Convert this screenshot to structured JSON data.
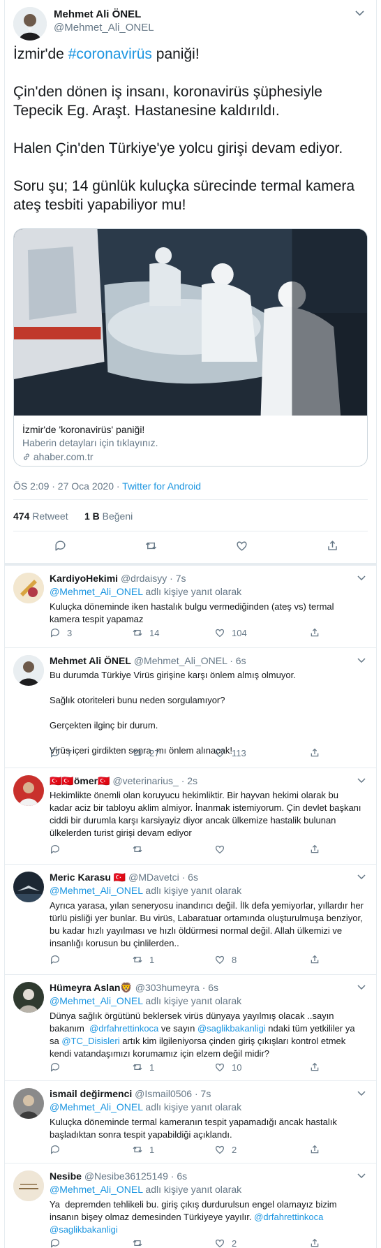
{
  "main_tweet": {
    "author_name": "Mehmet Ali ÖNEL",
    "author_handle": "@Mehmet_Ali_ONEL",
    "text_line1_prefix": "İzmir'de ",
    "text_line1_hashtag": "#coronavirüs",
    "text_line1_suffix": " paniği!",
    "text_rest": "Çin'den dönen iş insanı, koronavirüs şüphesiyle Tepecik Eg. Araşt. Hastanesine kaldırıldı.\n\nHalen Çin'den Türkiye'ye yolcu girişi devam ediyor.\n\nSoru şu; 14 günlük kuluçka sürecinde termal kamera ateş tesbiti yapabiliyor mu!",
    "card_title": "İzmir'de 'koronavirüs' paniği!",
    "card_description": "Haberin detayları için tıklayınız.",
    "card_url": "ahaber.com.tr",
    "timestamp": "ÖS 2:09 · 27 Oca 2020 · ",
    "source": "Twitter for Android",
    "retweets_count": "474",
    "retweets_label": "Retweet",
    "likes_count": "1 B",
    "likes_label": "Beğeni"
  },
  "replies": [
    {
      "name": "KardiyoHekimi",
      "handle": "@drdaisyy",
      "time": "· 7s",
      "reply_to_handle": "@Mehmet_Ali_ONEL",
      "reply_to_suffix": " adlı kişiye yanıt olarak",
      "text": "Kuluçka döneminde iken hastalık bulgu vermediğinden (ateş vs) termal kamera tespit yapamaz",
      "comments": "3",
      "retweets": "14",
      "likes": "104"
    },
    {
      "name": "Mehmet Ali ÖNEL",
      "handle": "@Mehmet_Ali_ONEL",
      "time": "· 6s",
      "text": "Bu durumda Türkiye Virüs girişine karşı önlem almış olmuyor.\n\nSağlık otoriteleri bunu neden sorgulamıyor?\n\nGerçekten ilginç bir durum.\n\nVirüs içeri girdikten sonra  mı önlem alınacak!",
      "comments": "7",
      "retweets": "27",
      "likes": "113"
    },
    {
      "name_flags_left": "🇹🇷🇹🇷",
      "name": "ömer",
      "name_flags_right": "🇹🇷",
      "handle": "@veterinarius_",
      "time": "· 2s",
      "text": "Hekimlikte önemli olan koruyucu hekimliktir. Bir hayvan hekimi olarak bu kadar aciz bir tabloyu aklim almiyor. İnanmak istemiyorum. Çin devlet başkanı ciddi bir durumla karşı karsiyayiz diyor ancak ülkemize hastalik bulunan ülkelerden turist girişi devam ediyor",
      "comments": "",
      "retweets": "",
      "likes": ""
    },
    {
      "name": "Meric Karasu",
      "name_flag": "🇹🇷",
      "handle": "@MDavetci",
      "time": "· 6s",
      "reply_to_handle": "@Mehmet_Ali_ONEL",
      "reply_to_suffix": " adlı kişiye yanıt olarak",
      "text": "Ayrıca yarasa, yılan seneryosu inandırıcı değil. İlk defa yemiyorlar, yıllardır her türlü pisliği yer bunlar. Bu virüs, Labaratuar ortamında oluşturulmuşa benziyor, bu kadar hızlı yayılması ve hızlı öldürmesi normal değil. Allah ülkemizi ve insanlığı korusun bu çinlilerden..",
      "comments": "",
      "retweets": "1",
      "likes": "8"
    },
    {
      "name": "Hümeyra Aslan",
      "name_emoji": "🦁",
      "handle": "@303humeyra",
      "time": "· 6s",
      "reply_to_handle": "@Mehmet_Ali_ONEL",
      "reply_to_suffix": " adlı kişiye yanıt olarak",
      "text_a": "Dünya sağlık örgütünü beklersek virüs dünyaya yayılmış olacak ..sayın bakanım  ",
      "mention_a": "@drfahrettinkoca",
      "text_b": " ve sayın ",
      "mention_b": "@saglikbakanligi",
      "text_c": " ndaki tüm yetkililer ya sa ",
      "mention_c": "@TC_Disisleri",
      "text_d": " artık kim ilgileniyorsa çinden giriş çıkışları kontrol etmek kendi vatandaşımızı korumamız için elzem değil midir?",
      "comments": "",
      "retweets": "1",
      "likes": "10"
    },
    {
      "name": "ismail değirmenci",
      "handle": "@Ismail0506",
      "time": "· 7s",
      "reply_to_handle": "@Mehmet_Ali_ONEL",
      "reply_to_suffix": " adlı kişiye yanıt olarak",
      "text": "Kuluçka döneminde termal kameranın tespit yapamadığı ancak hastalık başladıktan sonra tespit yapabildiği açıklandı.",
      "comments": "",
      "retweets": "1",
      "likes": "2"
    },
    {
      "name": "Nesibe",
      "handle": "@Nesibe36125149",
      "time": "· 6s",
      "reply_to_handle": "@Mehmet_Ali_ONEL",
      "reply_to_suffix": " adlı kişiye yanıt olarak",
      "text_a": "Ya  depremden tehlikeli bu. giriş çıkış durdurulsun engel olamayız bizim insanın bişey olmaz demesinden Türkiyeye yayılır. ",
      "mention_a": "@drfahrettinkoca",
      "mention_b": "@saglikbakanligi",
      "comments": "",
      "retweets": "",
      "likes": "2"
    }
  ],
  "colors": {
    "link": "#1b95e0",
    "muted": "#657786",
    "border": "#e6ecf0",
    "text": "#14171a"
  },
  "icons": [
    "chevron-down-icon",
    "reply-icon",
    "retweet-icon",
    "like-icon",
    "share-icon",
    "link-icon"
  ]
}
